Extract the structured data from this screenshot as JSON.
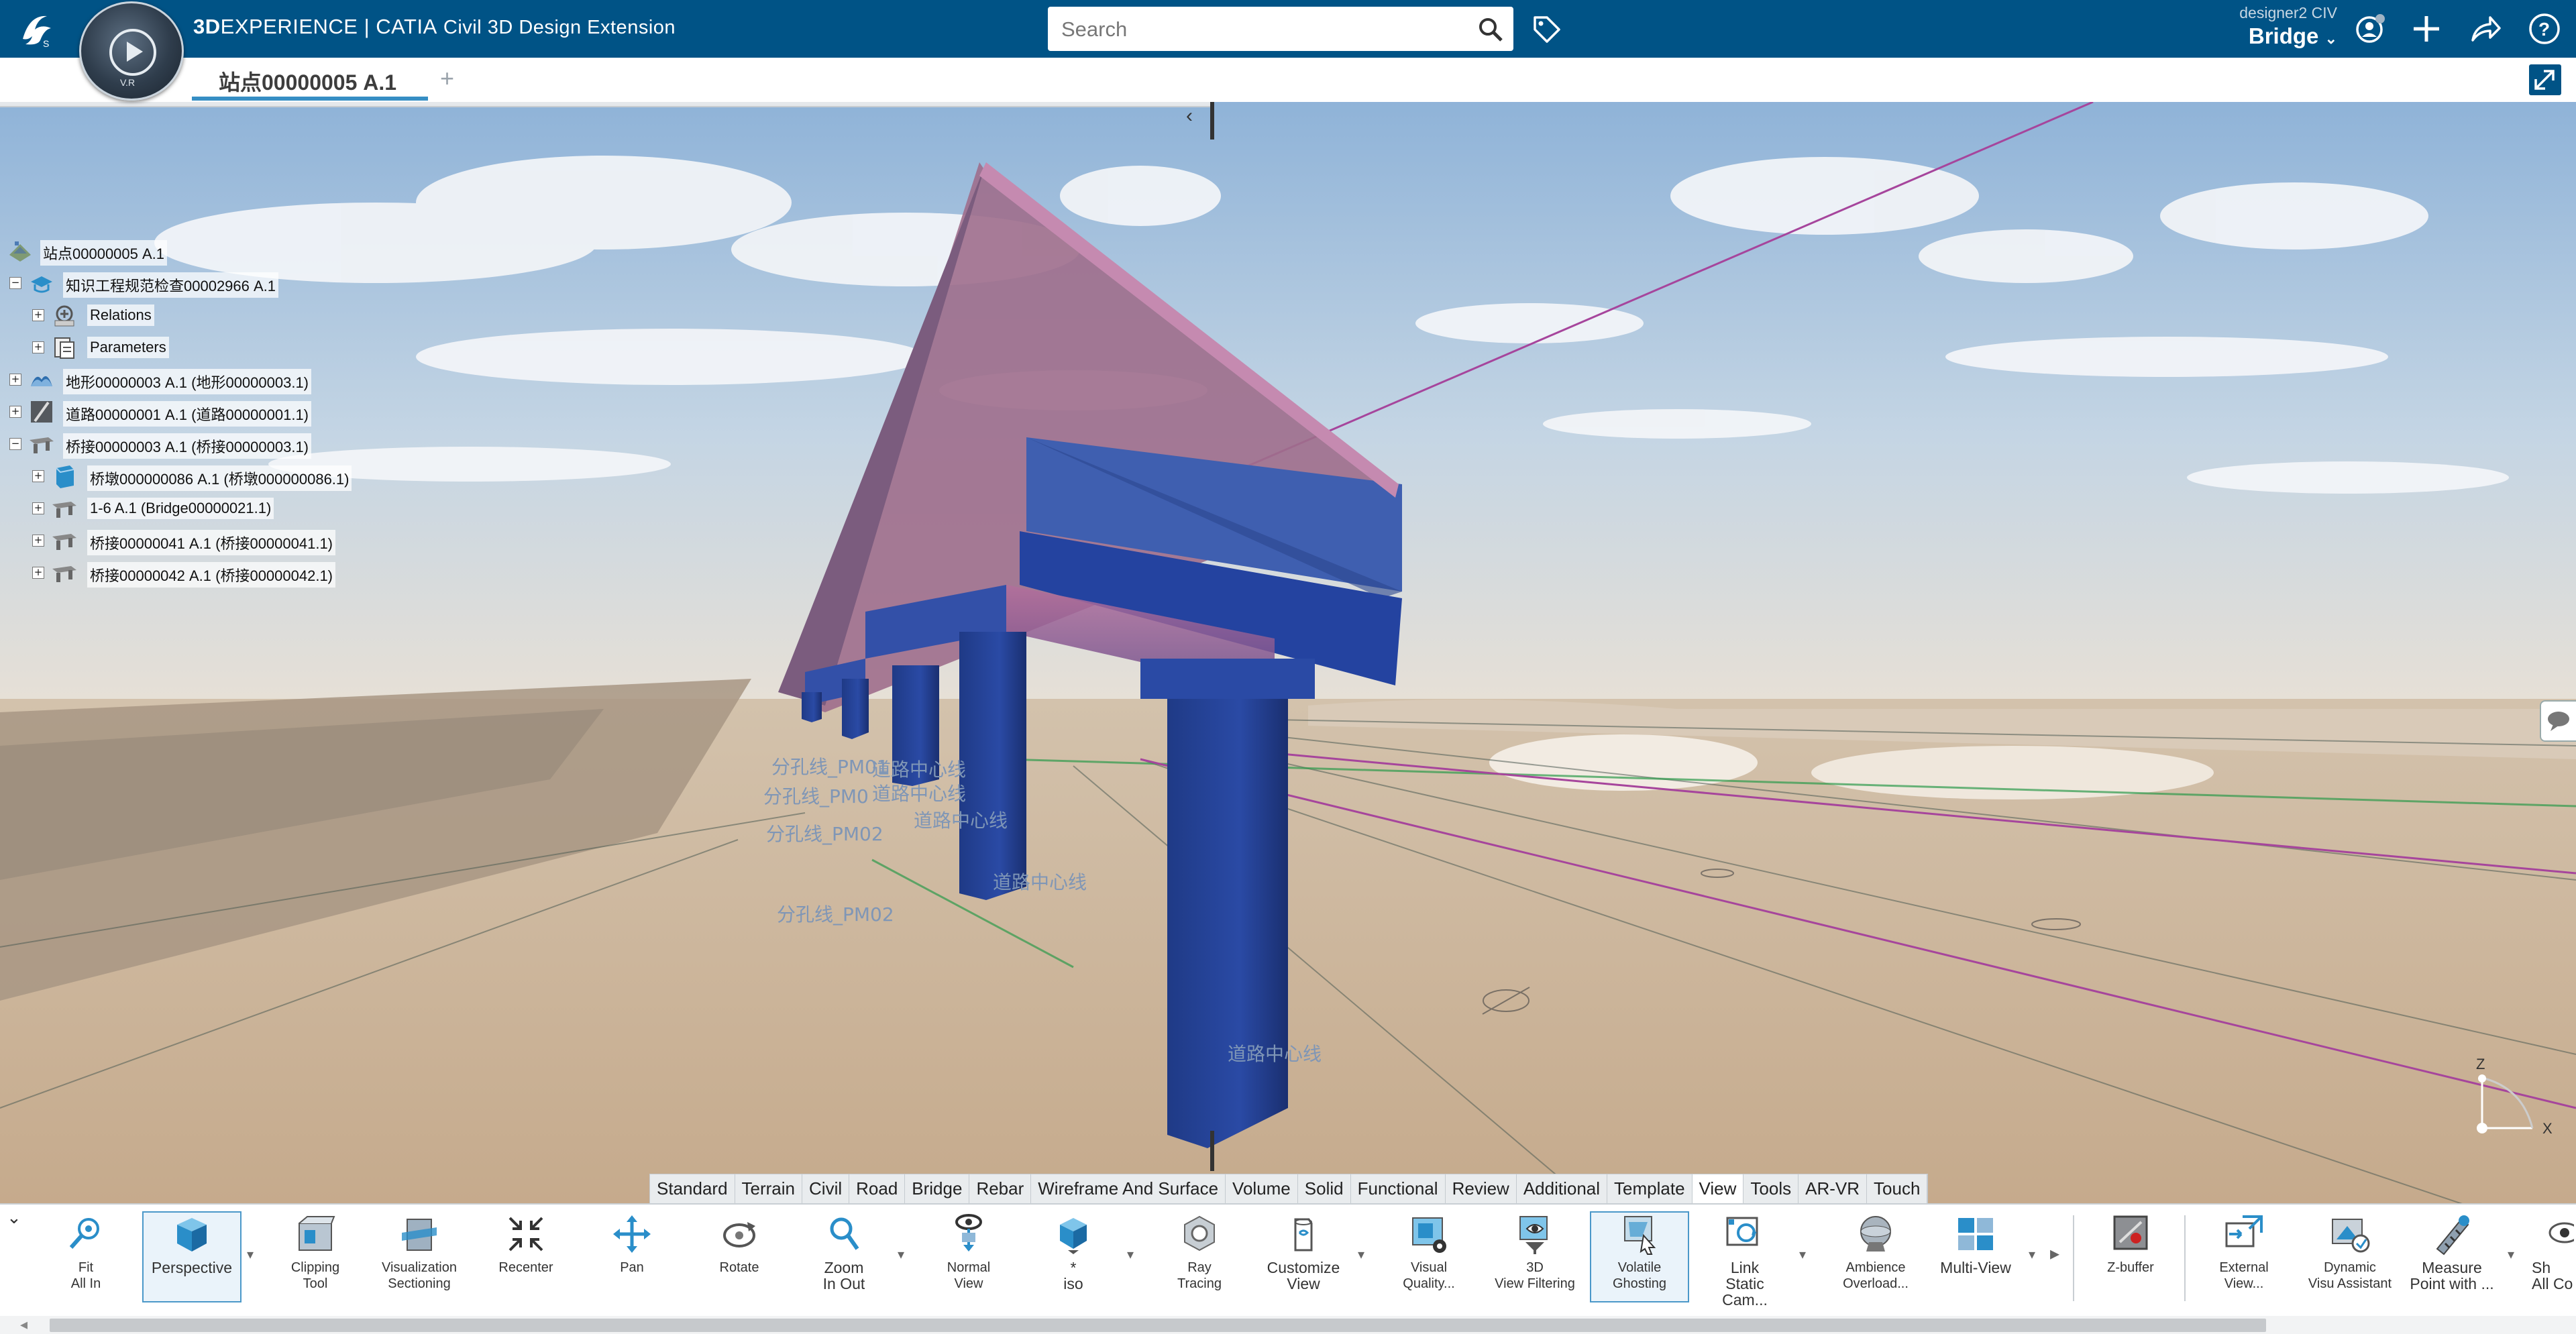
{
  "header": {
    "brand_bold": "3D",
    "brand_rest": "EXPERIENCE | CATIA",
    "app_name": "Civil 3D Design Extension",
    "compass_version": "V.R",
    "search_placeholder": "Search",
    "user_name": "designer2 CIV",
    "collab_space": "Bridge",
    "colors": {
      "topbar": "#005386",
      "accent": "#368ec4"
    }
  },
  "tabs": {
    "active_label": "站点00000005 A.1",
    "add_label": "+"
  },
  "tree": [
    {
      "label": "站点00000005 A.1",
      "expander": "",
      "icon": "site-icon"
    },
    {
      "label": "知识工程规范检查00002966 A.1",
      "expander": "−",
      "icon": "knowledge-check-icon"
    },
    {
      "label": "Relations",
      "expander": "+",
      "icon": "relations-icon"
    },
    {
      "label": "Parameters",
      "expander": "+",
      "icon": "parameters-icon"
    },
    {
      "label": "地形00000003 A.1 (地形00000003.1)",
      "expander": "+",
      "icon": "terrain-icon"
    },
    {
      "label": "道路00000001 A.1 (道路00000001.1)",
      "expander": "+",
      "icon": "road-icon"
    },
    {
      "label": "桥接00000003 A.1 (桥接00000003.1)",
      "expander": "−",
      "icon": "bridge-icon"
    },
    {
      "label": "桥墩000000086 A.1 (桥墩000000086.1)",
      "expander": "+",
      "icon": "pier-icon"
    },
    {
      "label": "1-6 A.1 (Bridge00000021.1)",
      "expander": "+",
      "icon": "bridge-icon"
    },
    {
      "label": "桥接00000041 A.1 (桥接00000041.1)",
      "expander": "+",
      "icon": "bridge-icon"
    },
    {
      "label": "桥接00000042 A.1 (桥接00000042.1)",
      "expander": "+",
      "icon": "bridge-icon"
    }
  ],
  "scene_labels": [
    "分孔线_PM01",
    "道路中心线",
    "分孔线_PM0",
    "道路中心线",
    "道路中心线",
    "分孔线_PM02",
    "道路中心线",
    "分孔线_PM02",
    "道路中心线"
  ],
  "axis": {
    "z": "Z",
    "x": "X"
  },
  "section_tabs": [
    "Standard",
    "Terrain",
    "Civil",
    "Road",
    "Bridge",
    "Rebar",
    "Wireframe And Surface",
    "Volume",
    "Solid",
    "Functional",
    "Review",
    "Additional",
    "Template",
    "View",
    "Tools",
    "AR-VR",
    "Touch"
  ],
  "active_section": "View",
  "commands": [
    {
      "label": "Fit\nAll In",
      "icon": "fit-all-in-icon"
    },
    {
      "label": "Perspective",
      "icon": "perspective-cube-icon"
    },
    {
      "label": "Clipping\nTool",
      "icon": "clipping-tool-icon"
    },
    {
      "label": "Visualization\nSectioning",
      "icon": "sectioning-icon"
    },
    {
      "label": "Recenter",
      "icon": "recenter-icon"
    },
    {
      "label": "Pan",
      "icon": "pan-icon"
    },
    {
      "label": "Rotate",
      "icon": "rotate-icon"
    },
    {
      "label": "Zoom\nIn Out",
      "icon": "zoom-icon"
    },
    {
      "label": "Normal\nView",
      "icon": "normal-view-icon"
    },
    {
      "label": "*\niso",
      "icon": "iso-view-icon"
    },
    {
      "label": "Ray\nTracing",
      "icon": "ray-tracing-icon"
    },
    {
      "label": "Customize\nView",
      "icon": "customize-view-icon"
    },
    {
      "label": "Visual\nQuality...",
      "icon": "visual-quality-icon"
    },
    {
      "label": "3D\nView Filtering",
      "icon": "view-filtering-icon"
    },
    {
      "label": "Volatile\nGhosting",
      "icon": "volatile-ghosting-icon"
    },
    {
      "label": "Link\nStatic Cam...",
      "icon": "link-static-camera-icon"
    },
    {
      "label": "Ambience\nOverload...",
      "icon": "ambience-icon"
    },
    {
      "label": "Multi-View",
      "icon": "multi-view-icon"
    },
    {
      "label": "Z-buffer",
      "icon": "z-buffer-icon"
    },
    {
      "label": "External\nView...",
      "icon": "external-view-icon"
    },
    {
      "label": "Dynamic\nVisu Assistant",
      "icon": "visu-assistant-icon"
    },
    {
      "label": "Measure\nPoint with ...",
      "icon": "measure-point-icon"
    },
    {
      "label": "Sh\nAll Co",
      "icon": "show-all-icon"
    }
  ]
}
